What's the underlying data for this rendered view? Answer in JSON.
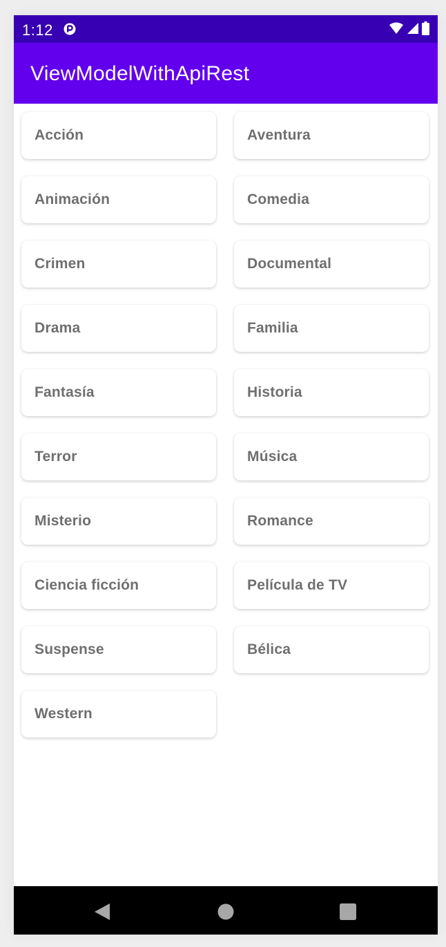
{
  "status_bar": {
    "time": "1:12",
    "notification_icon": "app-notification-icon",
    "icons": [
      "wifi-icon",
      "signal-icon",
      "battery-icon"
    ]
  },
  "app_bar": {
    "title": "ViewModelWithApiRest"
  },
  "genres": [
    "Acción",
    "Aventura",
    "Animación",
    "Comedia",
    "Crimen",
    "Documental",
    "Drama",
    "Familia",
    "Fantasía",
    "Historia",
    "Terror",
    "Música",
    "Misterio",
    "Romance",
    "Ciencia ficción",
    "Película de TV",
    "Suspense",
    "Bélica",
    "Western"
  ],
  "nav_bar": {
    "buttons": [
      "back-icon",
      "home-icon",
      "recents-icon"
    ]
  },
  "colors": {
    "status_bar": "#3700b3",
    "app_bar": "#6200ee",
    "card_text": "#6f6f6f",
    "nav_bar": "#000000"
  }
}
